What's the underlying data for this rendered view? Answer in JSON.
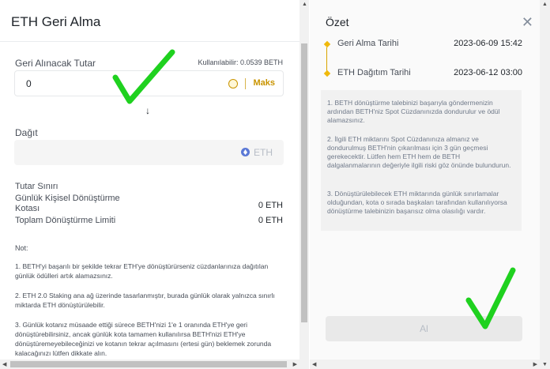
{
  "left_panel": {
    "title": "ETH Geri Alma",
    "amount_label": "Geri Alınacak Tutar",
    "available": "Kullanılabilir: 0.0539 BETH",
    "amount_value": "0",
    "max_label": "Maks",
    "distribute_label": "Dağıt",
    "distribute_currency": "ETH",
    "limits_title": "Tutar Sınırı",
    "limits": [
      {
        "label": "Günlük Kişisel Dönüştürme Kotası",
        "value": "0 ETH"
      },
      {
        "label": "Toplam Dönüştürme Limiti",
        "value": "0 ETH"
      }
    ],
    "notes_title": "Not:",
    "notes": [
      "1. BETH'yi başarılı bir şekilde tekrar ETH'ye dönüştürürseniz cüzdanlarınıza dağıtılan günlük ödülleri artık alamazsınız.",
      "2. ETH 2.0 Staking ana ağ üzerinde tasarlanmıştır, burada günlük olarak yalnızca sınırlı miktarda ETH dönüştürülebilir.",
      "3. Günlük kotanız müsaade ettiği sürece BETH'nizi 1'e 1 oranında ETH'ye geri dönüştürebilirsiniz, ancak günlük kota tamamen kullanılırsa BETH'nizi ETH'ye dönüştüremeyebileceğinizi ve kotanın tekrar açılmasını (ertesi gün) beklemek zorunda kalacağınızı lütfen dikkate alın."
    ]
  },
  "right_panel": {
    "title": "Özet",
    "timeline": [
      {
        "label": "Geri Alma Tarihi",
        "date": "2023-06-09 15:42"
      },
      {
        "label": "ETH Dağıtım Tarihi",
        "date": "2023-06-12 03:00"
      }
    ],
    "info": [
      "1. BETH dönüştürme talebinizi başarıyla göndermenizin ardından BETH'niz Spot Cüzdanınızda dondurulur ve ödül alamazsınız.",
      "2. İlgili ETH miktarını Spot Cüzdanınıza almanız ve dondurulmuş BETH'nin çıkarılması için 3 gün geçmesi gerekecektir. Lütfen hem ETH hem de BETH dalgalanmalarının değeriyle ilgili riski göz önünde bulundurun.",
      "3. Dönüştürülebilecek ETH miktarında günlük sınırlamalar olduğundan, kota o sırada başkaları tarafından kullanılıyorsa dönüştürme talebinizin başarısız olma olasılığı vardır."
    ],
    "submit_label": "Al"
  },
  "colors": {
    "accent": "#c99400",
    "check_green": "#1fd11f",
    "timeline_yellow": "#f0b90b"
  }
}
